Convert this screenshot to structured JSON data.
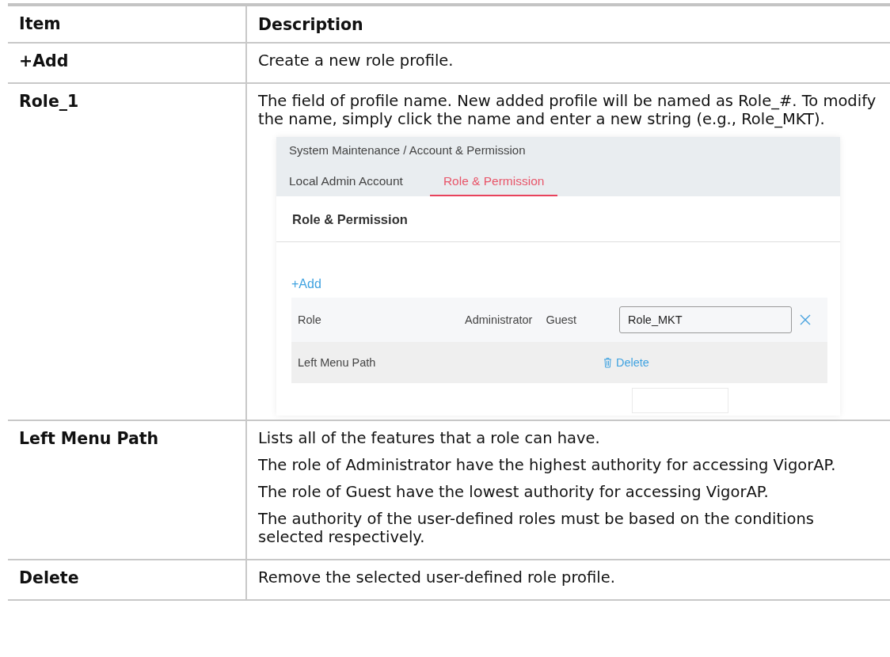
{
  "table": {
    "columns": [
      "Item",
      "Description"
    ],
    "rows": [
      {
        "item": "+Add",
        "paragraphs": [
          "Create a new role profile."
        ]
      },
      {
        "item": "Role_1",
        "paragraphs": [
          "The field of profile name. New added profile will be named as Role_#. To modify the name, simply click the name and enter a new string (e.g., Role_MKT)."
        ],
        "screenshot": {
          "breadcrumb": "System Maintenance / Account & Permission",
          "tabs": [
            {
              "label": "Local Admin Account",
              "selected": false
            },
            {
              "label": "Role & Permission",
              "selected": true
            }
          ],
          "panel_title": "Role & Permission",
          "add_link": "+Add",
          "role_row": {
            "label": "Role",
            "roles": [
              "Administrator",
              "Guest"
            ],
            "name_input": "Role_MKT"
          },
          "menu_row": {
            "label": "Left Menu Path",
            "delete_link": "Delete"
          }
        }
      },
      {
        "item": "Left Menu Path",
        "paragraphs": [
          "Lists all of the features that a role can have.",
          "The role of Administrator have the highest authority for accessing VigorAP.",
          "The role of Guest have the lowest authority for accessing VigorAP.",
          "The authority of the user-defined roles must be based on the conditions selected respectively."
        ]
      },
      {
        "item": "Delete",
        "paragraphs": [
          "Remove the selected user-defined role profile."
        ]
      }
    ]
  }
}
